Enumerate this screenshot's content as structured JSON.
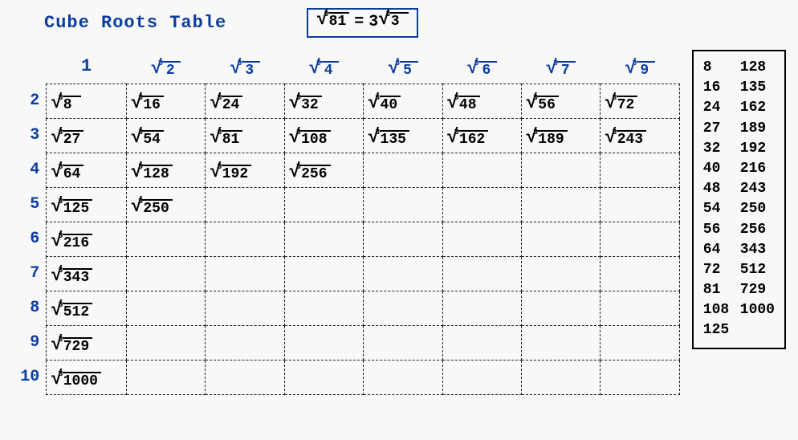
{
  "title": "Cube Roots Table",
  "example": {
    "left": "81",
    "coef": "3",
    "right": "3"
  },
  "col_headers": [
    "1",
    "2",
    "3",
    "4",
    "5",
    "6",
    "7",
    "9"
  ],
  "rows": [
    {
      "label": "2",
      "cells": [
        "8",
        "16",
        "24",
        "32",
        "40",
        "48",
        "56",
        "72"
      ]
    },
    {
      "label": "3",
      "cells": [
        "27",
        "54",
        "81",
        "108",
        "135",
        "162",
        "189",
        "243"
      ]
    },
    {
      "label": "4",
      "cells": [
        "64",
        "128",
        "192",
        "256",
        "",
        "",
        "",
        ""
      ]
    },
    {
      "label": "5",
      "cells": [
        "125",
        "250",
        "",
        "",
        "",
        "",
        "",
        ""
      ]
    },
    {
      "label": "6",
      "cells": [
        "216",
        "",
        "",
        "",
        "",
        "",
        "",
        ""
      ]
    },
    {
      "label": "7",
      "cells": [
        "343",
        "",
        "",
        "",
        "",
        "",
        "",
        ""
      ]
    },
    {
      "label": "8",
      "cells": [
        "512",
        "",
        "",
        "",
        "",
        "",
        "",
        ""
      ]
    },
    {
      "label": "9",
      "cells": [
        "729",
        "",
        "",
        "",
        "",
        "",
        "",
        ""
      ]
    },
    {
      "label": "10",
      "cells": [
        "1000",
        "",
        "",
        "",
        "",
        "",
        "",
        ""
      ]
    }
  ],
  "side_pairs": [
    [
      "8",
      "128"
    ],
    [
      "16",
      "135"
    ],
    [
      "24",
      "162"
    ],
    [
      "27",
      "189"
    ],
    [
      "32",
      "192"
    ],
    [
      "40",
      "216"
    ],
    [
      "48",
      "243"
    ],
    [
      "54",
      "250"
    ],
    [
      "56",
      "256"
    ],
    [
      "64",
      "343"
    ],
    [
      "72",
      "512"
    ],
    [
      "81",
      "729"
    ],
    [
      "108",
      "1000"
    ],
    [
      "125",
      ""
    ]
  ]
}
